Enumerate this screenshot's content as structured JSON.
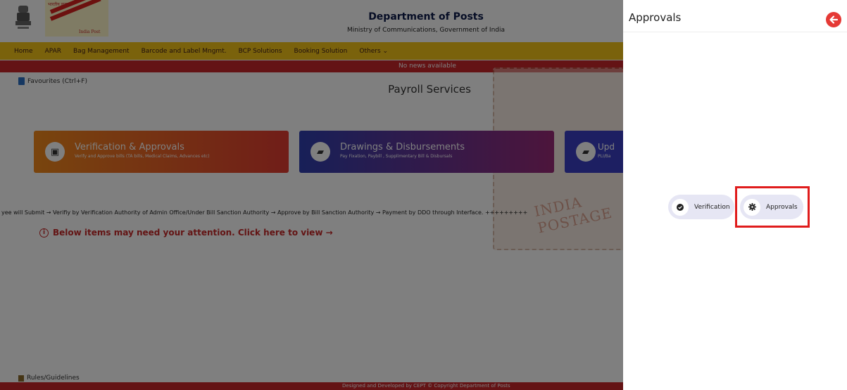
{
  "header": {
    "logo_top_text": "भारतीय डाक",
    "logo_bottom_text": "India Post",
    "title": "Department of Posts",
    "subtitle": "Ministry of Communications, Government of India"
  },
  "nav": {
    "items": [
      "Home",
      "APAR",
      "Bag Management",
      "Barcode and Label Mngmt.",
      "BCP Solutions",
      "Booking Solution",
      "Others"
    ]
  },
  "news": {
    "text": "No news available"
  },
  "favourites": {
    "label": "Favourites (Ctrl+F)"
  },
  "page": {
    "title": "Payroll Services",
    "stamp_text": "INDIA POSTAGE"
  },
  "cards": [
    {
      "title": "Verification & Approvals",
      "subtitle": "Verify and Approve bills (TA bills, Medical Claims, Advances etc)",
      "icon": "wallet-icon"
    },
    {
      "title": "Drawings & Disbursements",
      "subtitle": "Pay Fixation, Paybill , Supplimentary Bill & Disbursals",
      "icon": "folder-icon"
    },
    {
      "title": "Upd",
      "subtitle": "PLI/Ba",
      "icon": "folder-icon"
    }
  ],
  "flow_text": "yee will Submit → Verifiy by Verification Authority of Admin Office/Under Bill Sanction Authority → Approve by Bill Sanction Authority → Payment by DDO through Interface.    +++++++++",
  "attention": {
    "text": "Below items may need your attention. Click here to view →"
  },
  "rules": {
    "label": "Rules/Guidelines"
  },
  "footer": {
    "text": "Designed and Developed by CEPT © Copyright Department of Posts"
  },
  "panel": {
    "title": "Approvals",
    "options": [
      {
        "label": "Verification",
        "icon": "check-circle-icon"
      },
      {
        "label": "Approvals",
        "icon": "gear-icon"
      }
    ],
    "highlighted_option": "Approvals",
    "highlight_color": "#e01c1c",
    "back_button_color": "#e53935"
  }
}
